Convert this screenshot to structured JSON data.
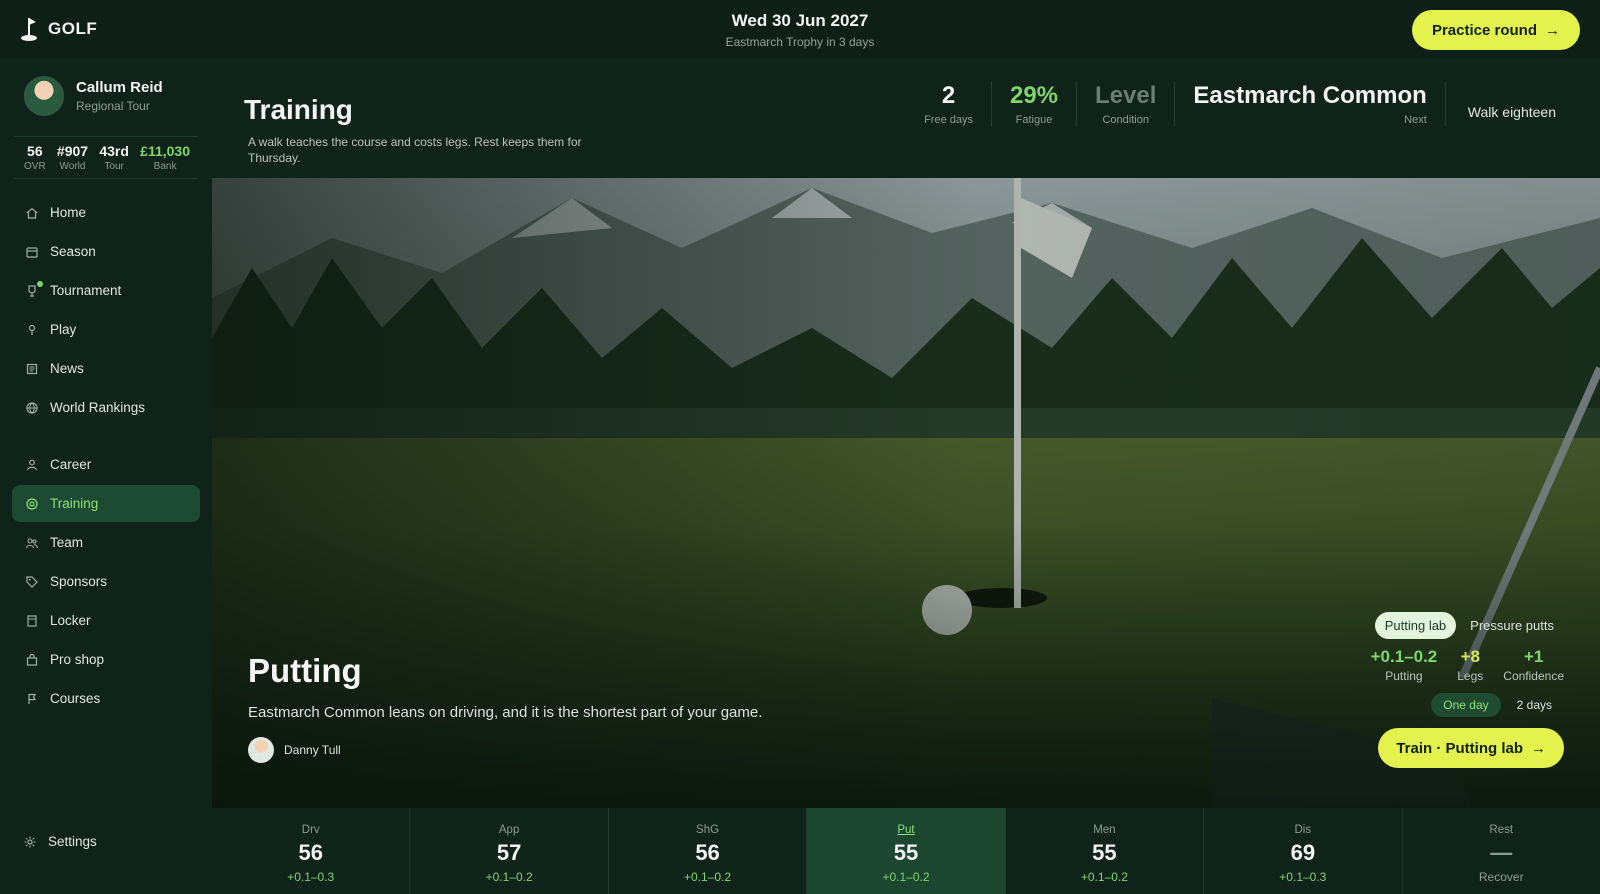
{
  "app": {
    "logo_text": "GOLF"
  },
  "header": {
    "date": "Wed 30 Jun 2027",
    "subtitle": "Eastmarch Trophy in 3 days",
    "practice_label": "Practice round"
  },
  "profile": {
    "name": "Callum Reid",
    "tour": "Regional Tour",
    "stats": [
      {
        "value": "56",
        "label": "OVR"
      },
      {
        "value": "#907",
        "label": "World"
      },
      {
        "value": "43rd",
        "label": "Tour"
      },
      {
        "value": "£11,030",
        "label": "Bank"
      }
    ]
  },
  "nav": {
    "primary": [
      {
        "label": "Home",
        "icon": "home-icon"
      },
      {
        "label": "Season",
        "icon": "calendar-icon"
      },
      {
        "label": "Tournament",
        "icon": "trophy-icon"
      },
      {
        "label": "Play",
        "icon": "pin-icon"
      },
      {
        "label": "News",
        "icon": "news-icon"
      },
      {
        "label": "World Rankings",
        "icon": "globe-icon"
      }
    ],
    "secondary": [
      {
        "label": "Career",
        "icon": "person-icon"
      },
      {
        "label": "Training",
        "icon": "target-icon"
      },
      {
        "label": "Team",
        "icon": "team-icon"
      },
      {
        "label": "Sponsors",
        "icon": "tag-icon"
      },
      {
        "label": "Locker",
        "icon": "locker-icon"
      },
      {
        "label": "Pro shop",
        "icon": "bag-icon"
      },
      {
        "label": "Courses",
        "icon": "flag-icon"
      }
    ],
    "settings_label": "Settings"
  },
  "page": {
    "title": "Training",
    "subtitle": "A walk teaches the course and costs legs. Rest keeps them for Thursday.",
    "metrics": [
      {
        "value": "2",
        "label": "Free days"
      },
      {
        "value": "29%",
        "label": "Fatigue"
      },
      {
        "value": "Level",
        "label": "Condition"
      },
      {
        "value": "Eastmarch Common",
        "label": "Next"
      }
    ],
    "walk_label": "Walk eighteen"
  },
  "hero": {
    "title": "Putting",
    "description": "Eastmarch Common leans on driving, and it is the shortest part of your game.",
    "coach": "Danny Tull",
    "drills": [
      "Putting lab",
      "Pressure putts"
    ],
    "gains": [
      {
        "value": "+0.1–0.2",
        "label": "Putting"
      },
      {
        "value": "+8",
        "label": "Legs"
      },
      {
        "value": "+1",
        "label": "Confidence"
      }
    ],
    "durations": [
      "One day",
      "2 days"
    ],
    "train_label": "Train · Putting lab"
  },
  "skills": [
    {
      "code": "Drv",
      "value": "56",
      "delta": "+0.1–0.3"
    },
    {
      "code": "App",
      "value": "57",
      "delta": "+0.1–0.2"
    },
    {
      "code": "ShG",
      "value": "56",
      "delta": "+0.1–0.2"
    },
    {
      "code": "Put",
      "value": "55",
      "delta": "+0.1–0.2"
    },
    {
      "code": "Men",
      "value": "55",
      "delta": "+0.1–0.2"
    },
    {
      "code": "Dis",
      "value": "69",
      "delta": "+0.1–0.3"
    },
    {
      "code": "Rest",
      "value": "—",
      "delta": "Recover"
    }
  ],
  "colors": {
    "accent": "#e4f24d",
    "positive": "#7fd66a",
    "background": "#0f211a"
  }
}
